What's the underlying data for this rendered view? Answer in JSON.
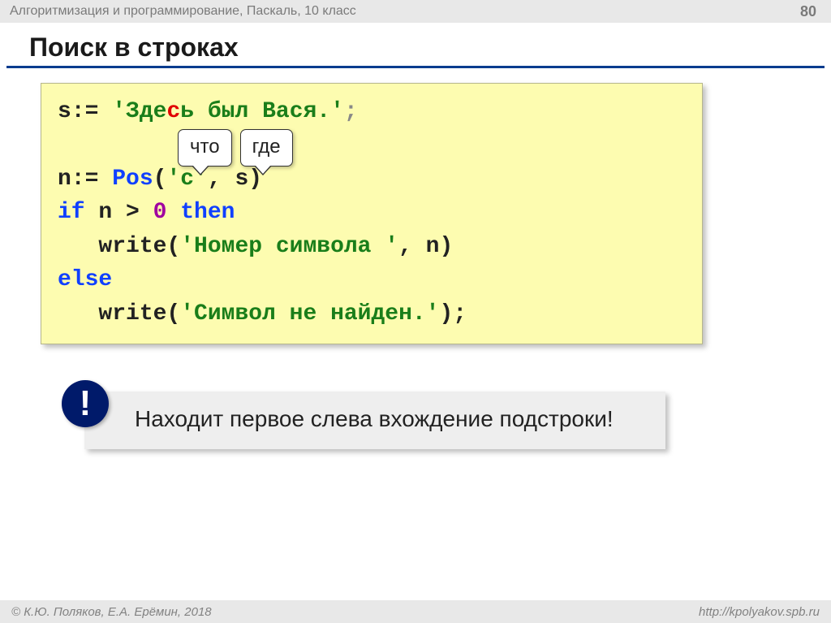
{
  "header": {
    "course": "Алгоритмизация и программирование, Паскаль, 10 класс",
    "page": "80"
  },
  "title": "Поиск в строках",
  "code": {
    "l1_pre": "s:= ",
    "l1_q1": "'",
    "l1_str1": "Зде",
    "l1_hl": "с",
    "l1_str2": "ь был Вася.",
    "l1_q2": "'",
    "l1_semicolon": ";",
    "bubble_what": "что",
    "bubble_where": "где",
    "l2_pre": "n:= ",
    "l2_pos": "Pos",
    "l2_lp": "(",
    "l2_arg_q": "'с'",
    "l2_comma": ", s",
    "l2_rp": ")",
    "l3_if": "if",
    "l3_mid": " n > ",
    "l3_zero": "0",
    "l3_sp": " ",
    "l3_then": "then",
    "l4_indent": "   write(",
    "l4_str": "'Номер символа '",
    "l4_tail": ", n)",
    "l5_else": "else",
    "l6_indent": "   write(",
    "l6_str": "'Символ не найден.'",
    "l6_tail": ");"
  },
  "note": {
    "icon": "!",
    "text": " Находит первое слева вхождение подстроки!"
  },
  "footer": {
    "left": "© К.Ю. Поляков, Е.А. Ерёмин, 2018",
    "right": "http://kpolyakov.spb.ru"
  }
}
